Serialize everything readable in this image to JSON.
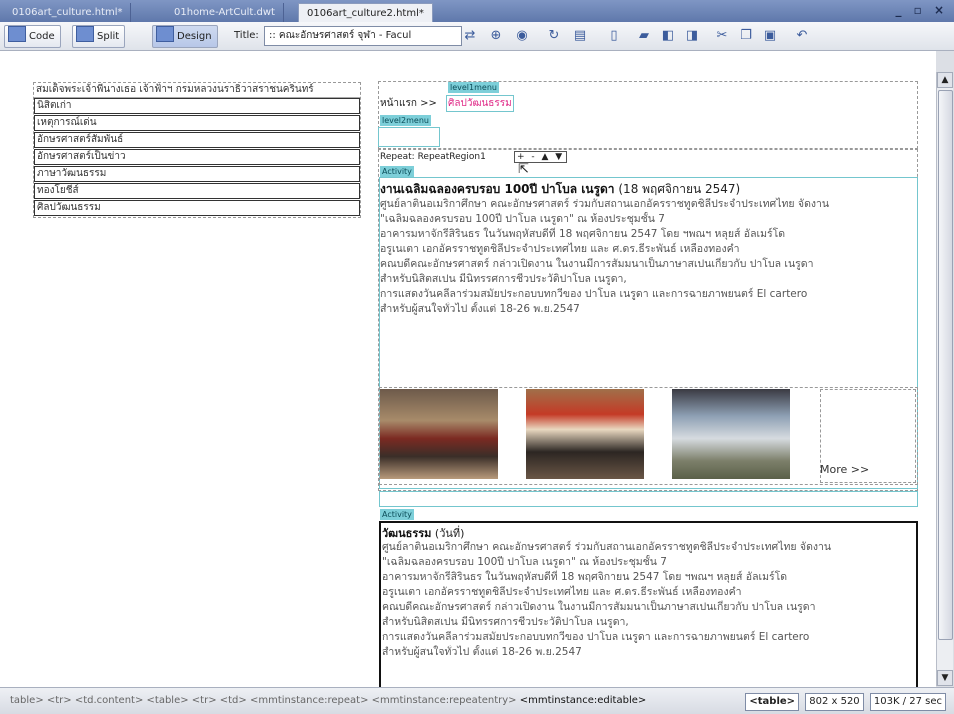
{
  "tabs": [
    {
      "label": "0106art_culture.html*",
      "active": false
    },
    {
      "label": "01home-ArtCult.dwt",
      "active": false
    },
    {
      "label": "0106art_culture2.html*",
      "active": true
    }
  ],
  "window_controls": "_ ▫ ×",
  "toolbar": {
    "code_label": "Code",
    "split_label": "Split",
    "design_label": "Design",
    "title_label": "Title:",
    "title_value": ":: คณะอักษรศาสตร์ จุฬา - Facul"
  },
  "nav": {
    "header": "สมเด็จพระเจ้าพี่นางเธอ เจ้าฟ้าฯ กรมหลวงนราธิวาสราชนครินทร์",
    "items": [
      "นิสิตเก่า",
      "เหตุการณ์เด่น",
      "อักษรศาสตร์สัมพันธ์",
      "อักษรศาสตร์เป็นข่าว",
      "ภาษาวัฒนธรรม",
      "ทองโยชีส์",
      "ศิลปวัฒนธรรม"
    ]
  },
  "content": {
    "level1_tag": "level1menu",
    "breadcrumb_home": "หน้าแรก >>",
    "breadcrumb_current": "ศิลปวัฒนธรรม",
    "level2_tag": "level2menu",
    "repeat_label": "Repeat: RepeatRegion1",
    "repeat_controls": "+ - ▲ ▼",
    "activity_tag": "Activity",
    "article1_title": "งานเฉลิมฉลองครบรอบ 100ปี ปาโบล เนรูดา",
    "article1_date": "(18 พฤศจิกายน 2547)",
    "article1_lines": [
      "ศูนย์ลาตินอเมริกาศึกษา คณะอักษรศาสตร์ ร่วมกับสถานเอกอัครราชทูตชิลีประจำประเทศไทย จัดงาน",
      "\"เฉลิมฉลองครบรอบ 100ปี ปาโบล เนรูดา\" ณ ห้องประชุมชั้น 7",
      "อาคารมหาจักรีสิรินธร ในวันพฤหัสบดีที่ 18 พฤศจิกายน 2547 โดย ฯพณฯ หลุยส์ อัลเมร์โด",
      "อรูเนเตา เอกอัครราชทูตชิลีประจำประเทศไทย และ ศ.ดร.ธีระพันธ์ เหลืองทองคำ",
      "คณบดีคณะอักษรศาสตร์ กล่าวเปิดงาน ในงานมีการสัมมนาเป็นภาษาสเปนเกี่ยวกับ ปาโบล เนรูดา",
      "สำหรับนิสิตสเปน มีนิทรรศการชีวประวัติปาโบล เนรูดา,",
      "การแสดงวันคลีลาร่วมสมัยประกอบบทกวีของ ปาโบล เนรูดา และการฉายภาพยนตร์ El cartero",
      "สำหรับผู้สนใจทั่วไป ตั้งแต่ 18-26 พ.ย.2547"
    ],
    "more_link": "More >>",
    "activity2_tag": "Activity",
    "article2_title": "วัฒนธรรม",
    "article2_suffix": "(วันที่)",
    "article2_lines": [
      "ศูนย์ลาตินอเมริกาศึกษา คณะอักษรศาสตร์ ร่วมกับสถานเอกอัครราชทูตชิลีประจำประเทศไทย จัดงาน",
      "\"เฉลิมฉลองครบรอบ 100ปี ปาโบล เนรูดา\" ณ ห้องประชุมชั้น 7",
      "อาคารมหาจักรีสิรินธร ในวันพฤหัสบดีที่ 18 พฤศจิกายน 2547 โดย ฯพณฯ หลุยส์ อัลเมร์โด",
      "อรูเนเตา เอกอัครราชทูตชิลีประจำประเทศไทย และ ศ.ดร.ธีระพันธ์ เหลืองทองคำ",
      "คณบดีคณะอักษรศาสตร์ กล่าวเปิดงาน ในงานมีการสัมมนาเป็นภาษาสเปนเกี่ยวกับ ปาโบล เนรูดา",
      "สำหรับนิสิตสเปน มีนิทรรศการชีวประวัติปาโบล เนรูดา,",
      "การแสดงวันคลีลาร่วมสมัยประกอบบทกวีของ ปาโบล เนรูดา และการฉายภาพยนตร์ El cartero",
      "สำหรับผู้สนใจทั่วไป ตั้งแต่ 18-26 พ.ย.2547"
    ]
  },
  "status": {
    "tag_path": "table> <tr> <td.content> <table> <tr> <td> <mmtinstance:repeat> <mmtinstance:repeatentry>",
    "tag_editable": "<mmtinstance:editable>",
    "tag_selected": "<table>",
    "dimensions": "802 x 520",
    "download": "103K / 27 sec"
  },
  "colors": {
    "accent_tag": "#7dcfd9",
    "link_pink": "#e02b88",
    "tab_bar": "#6b84b8"
  }
}
